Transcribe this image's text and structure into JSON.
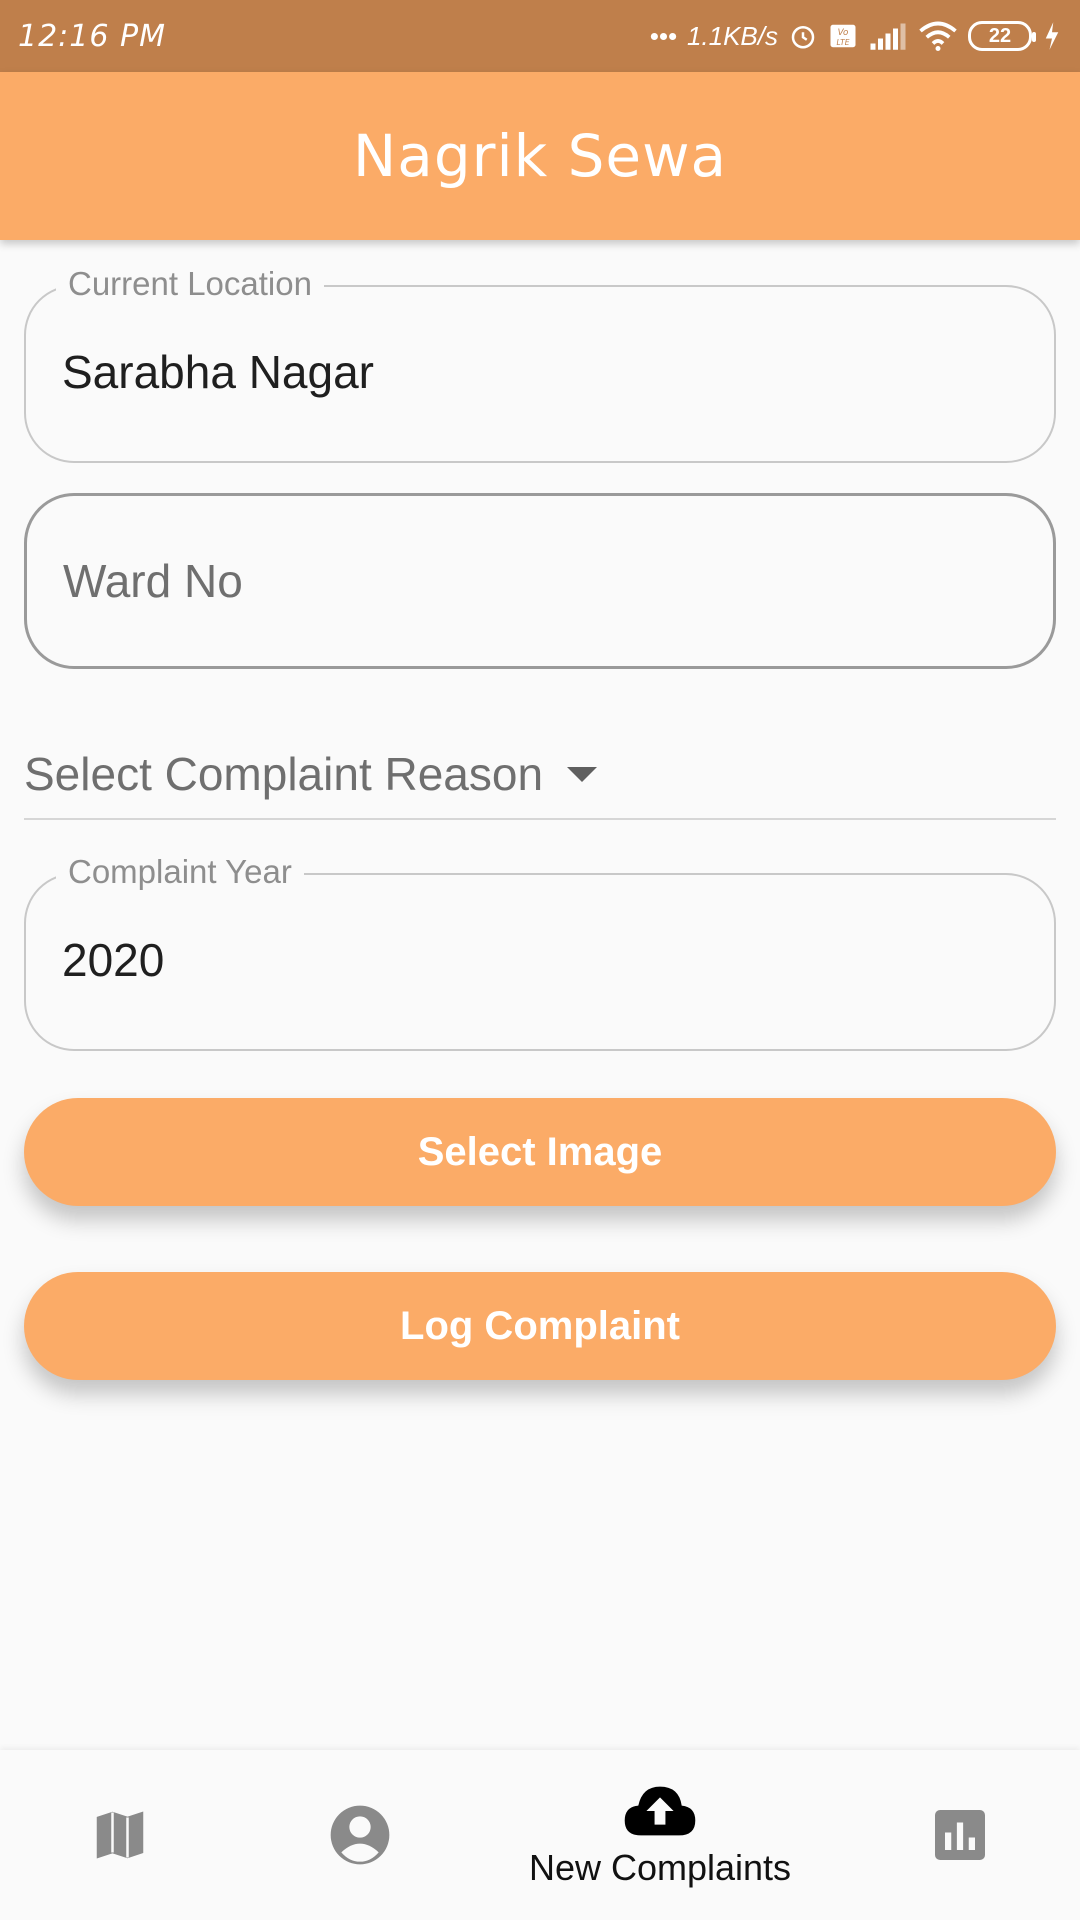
{
  "status_bar": {
    "time": "12:16 PM",
    "network_speed": "1.1KB/s",
    "battery": "22"
  },
  "app_bar": {
    "title": "Nagrik Sewa"
  },
  "form": {
    "current_location": {
      "label": "Current Location",
      "value": "Sarabha Nagar"
    },
    "ward_no": {
      "placeholder": "Ward No"
    },
    "complaint_reason": {
      "placeholder": "Select Complaint Reason"
    },
    "complaint_year": {
      "label": "Complaint Year",
      "value": "2020"
    }
  },
  "buttons": {
    "select_image": "Select Image",
    "log_complaint": "Log Complaint"
  },
  "bottom_nav": {
    "items": [
      {
        "icon": "map-icon",
        "label": ""
      },
      {
        "icon": "account-icon",
        "label": ""
      },
      {
        "icon": "cloud-upload-icon",
        "label": "New Complaints"
      },
      {
        "icon": "bar-chart-icon",
        "label": ""
      }
    ]
  },
  "colors": {
    "status_bar": "#bf7f4b",
    "accent": "#fbab67",
    "background": "#fafafa"
  }
}
